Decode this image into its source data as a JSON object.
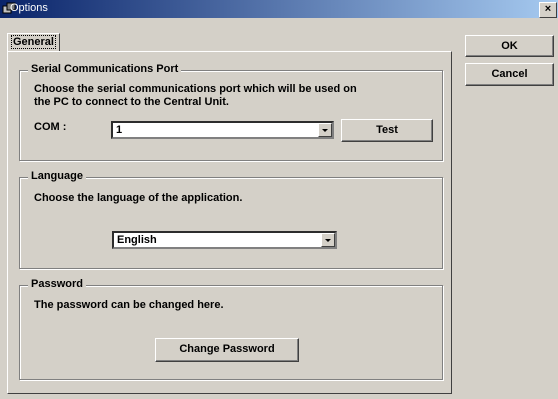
{
  "window": {
    "title": "Options",
    "close_glyph": "×"
  },
  "tabs": [
    {
      "label": "General"
    }
  ],
  "dialog_buttons": {
    "ok": "OK",
    "cancel": "Cancel"
  },
  "serial": {
    "legend": "Serial Communications Port",
    "description_line1": "Choose the serial communications port which will be used on",
    "description_line2": "the PC to connect to the Central Unit.",
    "com_label": "COM :",
    "com_value": "1",
    "test_label": "Test"
  },
  "language": {
    "legend": "Language",
    "description": "Choose the language of the application.",
    "value": "English"
  },
  "password": {
    "legend": "Password",
    "description": "The password can be changed here.",
    "change_label": "Change Password"
  }
}
